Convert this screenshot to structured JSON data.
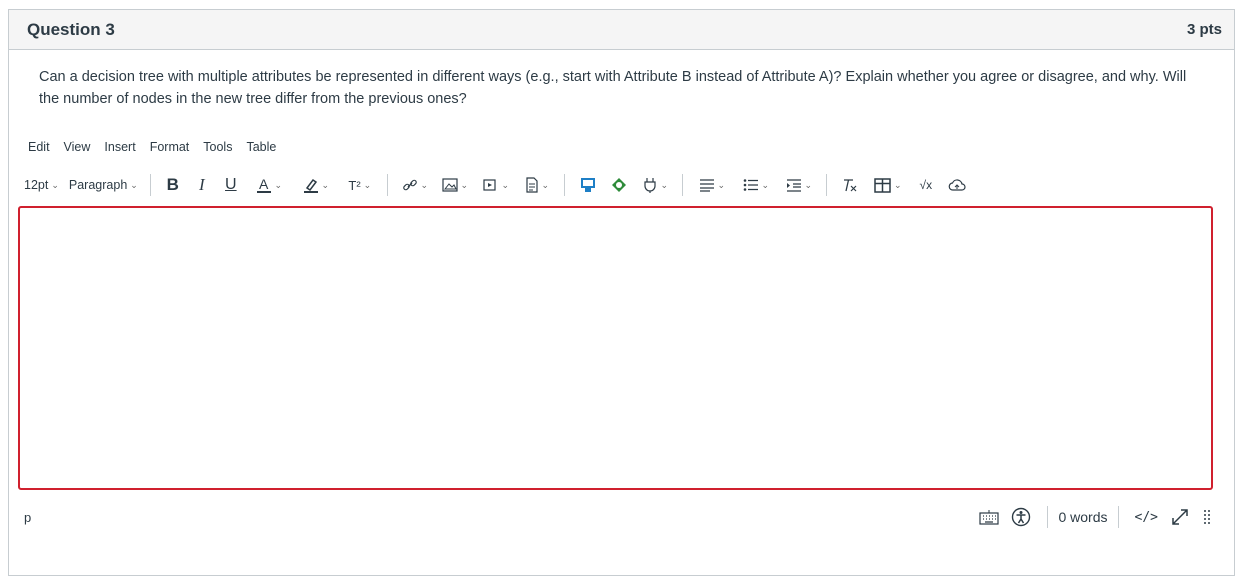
{
  "question": {
    "title": "Question 3",
    "points": "3 pts",
    "text": "Can a decision tree with multiple attributes be represented in different ways (e.g., start with Attribute B instead of Attribute A)? Explain whether you agree or disagree, and why. Will the number of nodes in the new tree differ from the previous ones?"
  },
  "editor": {
    "menu": [
      "Edit",
      "View",
      "Insert",
      "Format",
      "Tools",
      "Table"
    ],
    "font_size": "12pt",
    "block_format": "Paragraph",
    "superscript_label": "T²",
    "value": "",
    "border_color": "#d0202e"
  },
  "status": {
    "path": "p",
    "word_count": "0 words",
    "html_toggle": "</>"
  }
}
